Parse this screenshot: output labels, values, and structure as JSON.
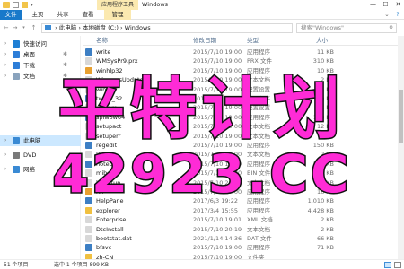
{
  "window": {
    "title": "Windows",
    "context_tab": "应用程序工具",
    "minimize": "—",
    "maximize": "☐",
    "close": "✕",
    "help": "?"
  },
  "ribbon": {
    "tabs": [
      "文件",
      "主页",
      "共享",
      "查看",
      "管理"
    ],
    "collapse_glyph": "⌄"
  },
  "address": {
    "path": [
      "此电脑",
      "本地磁盘 (C:)",
      "Windows"
    ],
    "separator": "›",
    "search_placeholder": "搜索\"Windows\""
  },
  "nav": {
    "items": [
      {
        "label": "快速访问",
        "icon": "star-icon",
        "color": "#1f7fd4"
      },
      {
        "label": "桌面",
        "icon": "desktop-icon",
        "color": "#2d7ed8",
        "pin": "✱"
      },
      {
        "label": "下载",
        "icon": "download-icon",
        "color": "#2d7ed8",
        "pin": "✱"
      },
      {
        "label": "文档",
        "icon": "document-icon",
        "color": "#8aa3bd",
        "pin": "✱"
      },
      {
        "label": "此电脑",
        "icon": "computer-icon",
        "color": "#3a8ad4",
        "selected": true
      },
      {
        "label": "DVD",
        "icon": "dvd-icon",
        "color": "#7a7a7a"
      },
      {
        "label": "网络",
        "icon": "network-icon",
        "color": "#3a8ad4"
      }
    ]
  },
  "columns": {
    "name": "名称",
    "date": "修改日期",
    "type": "类型",
    "size": "大小"
  },
  "files": [
    {
      "name": "write",
      "date": "2015/7/10 19:00",
      "type": "应用程序",
      "size": "11 KB",
      "icon": "app-icon",
      "color": "#3d7fc4"
    },
    {
      "name": "WMSysPr9.prx",
      "date": "2015/7/10 19:00",
      "type": "PRX 文件",
      "size": "310 KB",
      "icon": "file-icon",
      "color": "#d8d8d8"
    },
    {
      "name": "winhlp32",
      "date": "2015/7/10 19:00",
      "type": "应用程序",
      "size": "10 KB",
      "icon": "app-icon",
      "color": "#e8a030"
    },
    {
      "name": "WindowsUpdate",
      "date": "2015/7/10 19:00",
      "type": "文本文档",
      "size": "2 KB",
      "icon": "text-icon",
      "color": "#d8d8d8"
    },
    {
      "name": "win",
      "date": "2015/7/10 19:00",
      "type": "配置设置",
      "size": "1 KB",
      "icon": "settings-file-icon",
      "color": "#d8d8d8"
    },
    {
      "name": "twain_32",
      "date": "2015/7/10 19:00",
      "type": "应用程序",
      "size": "50 KB",
      "icon": "app-icon",
      "color": "#3d7fc4"
    },
    {
      "name": "system",
      "date": "2015/7/10 19:00",
      "type": "配置设置",
      "size": "1 KB",
      "icon": "settings-file-icon",
      "color": "#d8d8d8"
    },
    {
      "name": "splwow64",
      "date": "2015/7/10 19:00",
      "type": "应用程序",
      "size": "118 KB",
      "icon": "app-icon",
      "color": "#3d7fc4"
    },
    {
      "name": "setupact",
      "date": "2015/7/10 19:00",
      "type": "文本文档",
      "size": "12 KB",
      "icon": "text-icon",
      "color": "#d8d8d8"
    },
    {
      "name": "setuperr",
      "date": "2015/7/10 19:00",
      "type": "文本文档",
      "size": "0 KB",
      "icon": "text-icon",
      "color": "#d8d8d8"
    },
    {
      "name": "regedit",
      "date": "2015/7/10 19:00",
      "type": "应用程序",
      "size": "150 KB",
      "icon": "app-icon",
      "color": "#3d7fc4"
    },
    {
      "name": "PFRO",
      "date": "2015/7/10 19:00",
      "type": "文本文档",
      "size": "2 KB",
      "icon": "text-icon",
      "color": "#d8d8d8"
    },
    {
      "name": "notepad",
      "date": "2015/7/10 19:00",
      "type": "应用程序",
      "size": "242 KB",
      "icon": "app-icon",
      "color": "#3d7fc4"
    },
    {
      "name": "mib",
      "date": "2015/7/10 19:00",
      "type": "BIN 文件",
      "size": "42 KB",
      "icon": "file-icon",
      "color": "#d8d8d8"
    },
    {
      "name": "lsasetup",
      "date": "2015/7/10 20:20",
      "type": "文本文档",
      "size": "2 KB",
      "icon": "text-icon",
      "color": "#d8d8d8"
    },
    {
      "name": "hh",
      "date": "2015/7/10 19:00",
      "type": "应用程序",
      "size": "16 KB",
      "icon": "app-icon",
      "color": "#e8a030"
    },
    {
      "name": "HelpPane",
      "date": "2017/6/3 19:22",
      "type": "应用程序",
      "size": "1,010 KB",
      "icon": "help-icon",
      "color": "#3d7fc4"
    },
    {
      "name": "explorer",
      "date": "2017/3/4 15:55",
      "type": "应用程序",
      "size": "4,428 KB",
      "icon": "folder-icon",
      "color": "#f0c040"
    },
    {
      "name": "Enterprise",
      "date": "2015/7/10 19:01",
      "type": "XML 文档",
      "size": "2 KB",
      "icon": "xml-icon",
      "color": "#d8d8d8"
    },
    {
      "name": "DtcInstall",
      "date": "2015/7/10 20:19",
      "type": "文本文档",
      "size": "2 KB",
      "icon": "text-icon",
      "color": "#d8d8d8"
    },
    {
      "name": "bootstat.dat",
      "date": "2021/1/14 14:36",
      "type": "DAT 文件",
      "size": "66 KB",
      "icon": "file-icon",
      "color": "#d8d8d8"
    },
    {
      "name": "bfsvc",
      "date": "2015/7/10 19:00",
      "type": "应用程序",
      "size": "71 KB",
      "icon": "app-icon",
      "color": "#3d7fc4"
    },
    {
      "name": "zh-CN",
      "date": "2015/7/10 19:00",
      "type": "文件夹",
      "size": "",
      "icon": "folder-icon",
      "color": "#f0c040"
    }
  ],
  "status": {
    "item_count": "51 个项目",
    "selection": "选中 1 个项目  899 KB"
  },
  "watermark": {
    "line1": "平特计划",
    "line2": "42923.CC"
  }
}
